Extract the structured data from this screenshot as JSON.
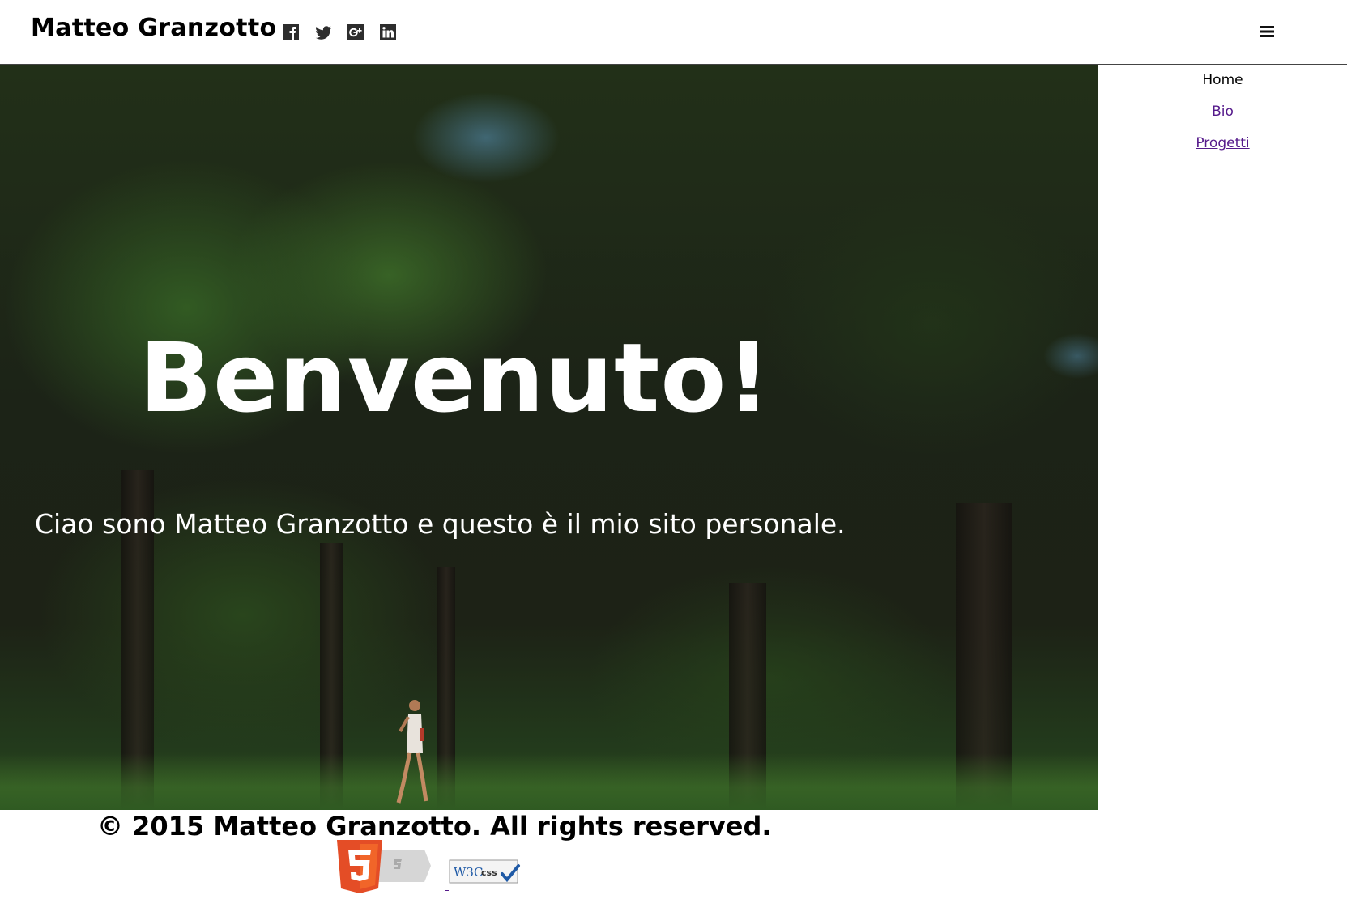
{
  "header": {
    "site_title": "Matteo Granzotto",
    "social_icons": [
      "facebook-icon",
      "twitter-icon",
      "google-plus-icon",
      "linkedin-icon"
    ],
    "menu_icon": "hamburger-menu-icon"
  },
  "hero": {
    "title": "Benvenuto!",
    "subtitle": "Ciao sono Matteo Granzotto e questo è il mio sito personale."
  },
  "nav": {
    "items": [
      {
        "label": "Home"
      },
      {
        "label": "Bio"
      },
      {
        "label": "Progetti"
      }
    ]
  },
  "footer": {
    "copyright": "© 2015 Matteo Granzotto. All rights reserved.",
    "badges": [
      "html5-badge",
      "w3c-css-badge"
    ],
    "css_badge_w3c": "W3C",
    "css_badge_css": "css"
  },
  "colors": {
    "visited_link": "#551a8b",
    "html5_orange": "#e44d26"
  }
}
